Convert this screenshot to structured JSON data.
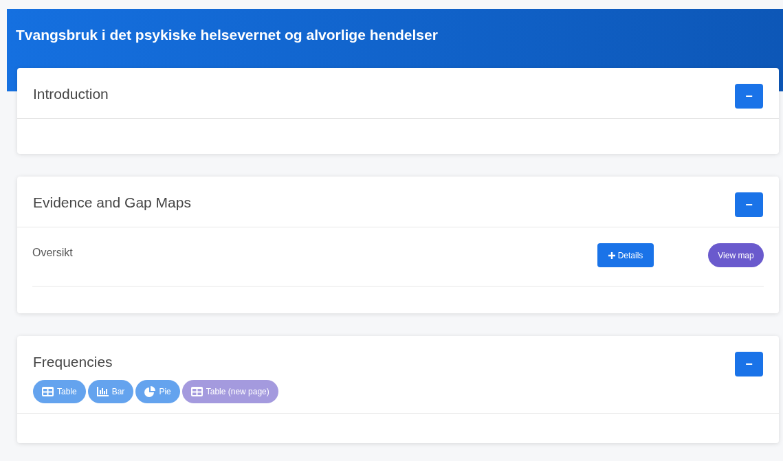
{
  "header": {
    "title": "Tvangsbruk i det psykiske helsevernet og alvorlige hendelser"
  },
  "sections": [
    {
      "kind": "intro",
      "title": "Introduction",
      "toggle": "−"
    },
    {
      "kind": "maps",
      "title": "Evidence and Gap Maps",
      "toggle": "−",
      "rows": [
        {
          "label": "Oversikt",
          "details": "Details",
          "view": "View map"
        }
      ]
    },
    {
      "kind": "freq",
      "title": "Frequencies",
      "toggle": "−",
      "views": [
        {
          "kind": "table",
          "label": "Table",
          "color": "#64a3ee"
        },
        {
          "kind": "bar",
          "label": "Bar",
          "color": "#64a3ee"
        },
        {
          "kind": "pie",
          "label": "Pie",
          "color": "#64a3ee"
        },
        {
          "kind": "table",
          "label": "Table (new page)",
          "color": "#a49ade"
        }
      ]
    }
  ]
}
